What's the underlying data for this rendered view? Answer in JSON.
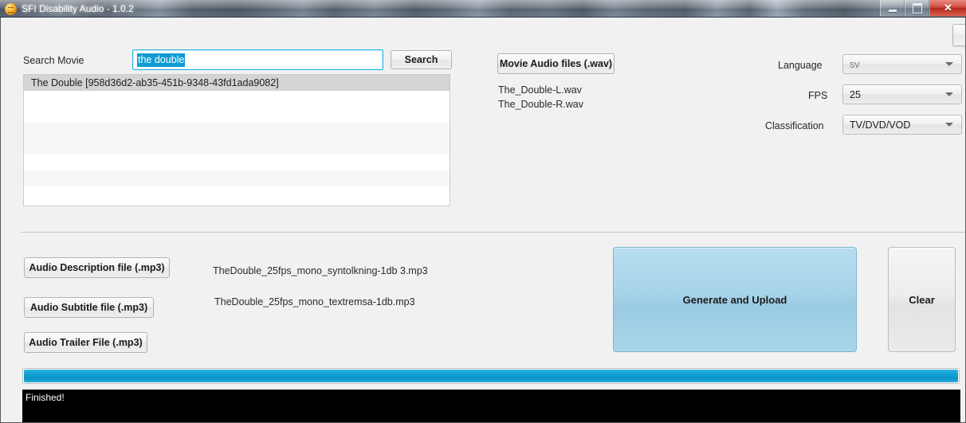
{
  "window": {
    "title": "SFI Disability Audio - 1.0.2",
    "icon": "disc-icon",
    "controls": {
      "minimize": "minimize-icon",
      "maximize": "maximize-icon",
      "close": "✕"
    }
  },
  "search": {
    "label": "Search Movie",
    "input_value": "the double",
    "input_placeholder": "",
    "button_label": "Search",
    "results": [
      {
        "text": "The Double  [958d36d2-ab35-451b-9348-43fd1ada9082]",
        "selected": true
      },
      {
        "text": "",
        "selected": false
      },
      {
        "text": "",
        "selected": false
      },
      {
        "text": "",
        "selected": false
      },
      {
        "text": "",
        "selected": false
      },
      {
        "text": "",
        "selected": false
      },
      {
        "text": "",
        "selected": false
      },
      {
        "text": "",
        "selected": false
      }
    ]
  },
  "audio_files": {
    "button_label": "Movie Audio files (.wav)",
    "files": [
      "The_Double-L.wav",
      "The_Double-R.wav"
    ]
  },
  "settings": {
    "language": {
      "label": "Language",
      "value": "sv"
    },
    "fps": {
      "label": "FPS",
      "value": "25"
    },
    "classification": {
      "label": "Classification",
      "value": "TV/DVD/VOD"
    }
  },
  "mp3_section": {
    "description": {
      "button_label": "Audio Description file (.mp3)",
      "file": "TheDouble_25fps_mono_syntolkning-1db 3.mp3"
    },
    "subtitle": {
      "button_label": "Audio Subtitle file (.mp3)",
      "file": "TheDouble_25fps_mono_textremsa-1db.mp3"
    },
    "trailer": {
      "button_label": "Audio Trailer File (.mp3)",
      "file": ""
    }
  },
  "actions": {
    "generate_label": "Generate and Upload",
    "clear_label": "Clear"
  },
  "progress": {
    "percent": 100
  },
  "console": {
    "lines": [
      "Finished!"
    ]
  },
  "colors": {
    "accent_blue": "#0f9bd4",
    "progress_blue": "#14a0d2",
    "primary_button": "#a7d3e8",
    "selection_blue": "#0f9bd4",
    "console_bg": "#000000"
  }
}
